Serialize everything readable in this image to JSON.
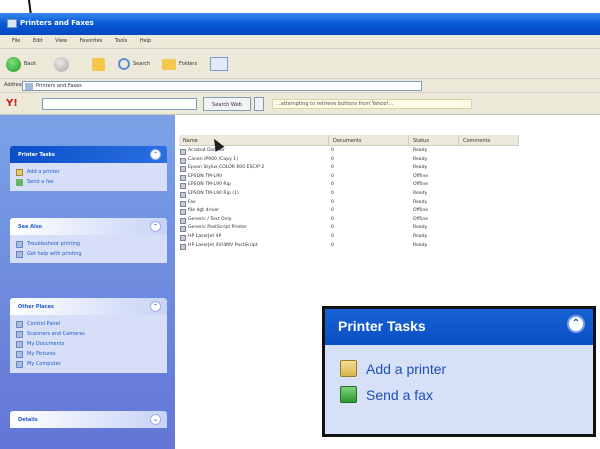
{
  "window": {
    "title": "Printers and Faxes"
  },
  "menu": [
    "File",
    "Edit",
    "View",
    "Favorites",
    "Tools",
    "Help"
  ],
  "toolbar": {
    "back": "Back",
    "search": "Search",
    "folders": "Folders"
  },
  "address": {
    "label": "Address",
    "value": "Printers and Faxes"
  },
  "yahoo_bar": {
    "logo": "Y!",
    "search_button": "Search Web",
    "message": "...attempting to retrieve buttons from Yahoo!..."
  },
  "taskpane": {
    "printer_tasks": {
      "title": "Printer Tasks",
      "items": [
        "Add a printer",
        "Send a fax"
      ]
    },
    "see_also": {
      "title": "See Also",
      "items": [
        "Troubleshoot printing",
        "Get help with printing"
      ]
    },
    "other_places": {
      "title": "Other Places",
      "items": [
        "Control Panel",
        "Scanners and Cameras",
        "My Documents",
        "My Pictures",
        "My Computer"
      ]
    },
    "details": {
      "title": "Details"
    }
  },
  "filelist": {
    "columns": [
      "Name",
      "Documents",
      "Status",
      "Comments"
    ],
    "rows": [
      {
        "name": "Acrobat Distiller",
        "docs": "0",
        "status": "Ready"
      },
      {
        "name": "Canon iP900 (Copy 1)",
        "docs": "0",
        "status": "Ready"
      },
      {
        "name": "Epson Stylus COLOR 600 ESC/P 2",
        "docs": "0",
        "status": "Ready"
      },
      {
        "name": "EPSON TM-L90",
        "docs": "0",
        "status": "Offline"
      },
      {
        "name": "EPSON TM-L90 Rip",
        "docs": "0",
        "status": "Offline"
      },
      {
        "name": "EPSON TM-L90 Rip (1)",
        "docs": "0",
        "status": "Ready"
      },
      {
        "name": "Fax",
        "docs": "0",
        "status": "Ready"
      },
      {
        "name": "file dgt driver",
        "docs": "0",
        "status": "Offline"
      },
      {
        "name": "Generic / Text Only",
        "docs": "0",
        "status": "Offline"
      },
      {
        "name": "Generic PostScript Printer",
        "docs": "0",
        "status": "Ready"
      },
      {
        "name": "HP LaserJet 4P",
        "docs": "0",
        "status": "Ready"
      },
      {
        "name": "HP LaserJet 4V/4MV PostScript",
        "docs": "0",
        "status": "Ready"
      }
    ]
  },
  "zoom": {
    "title": "Printer Tasks",
    "items": [
      "Add a printer",
      "Send a fax"
    ]
  }
}
